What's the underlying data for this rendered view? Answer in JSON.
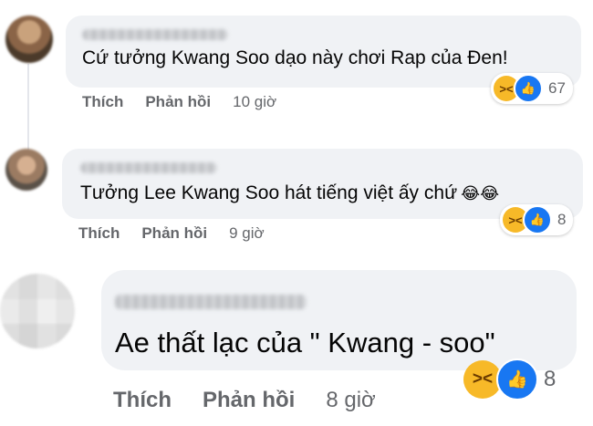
{
  "comments": [
    {
      "text": "Cứ tưởng Kwang Soo dạo này chơi Rap của Đen!",
      "like_label": "Thích",
      "reply_label": "Phản hồi",
      "time": "10 giờ",
      "reaction_count": "67",
      "reaction_icons": [
        "haha-icon",
        "like-icon"
      ]
    },
    {
      "text": "Tưởng Lee Kwang Soo hát tiếng việt ấy chứ",
      "inline_emoji": "😂😂",
      "like_label": "Thích",
      "reply_label": "Phản hồi",
      "time": "9 giờ",
      "reaction_count": "8",
      "reaction_icons": [
        "haha-icon",
        "like-icon"
      ]
    },
    {
      "text": "Ae thất lạc của \" Kwang - soo\"",
      "like_label": "Thích",
      "reply_label": "Phản hồi",
      "time": "8 giờ",
      "reaction_count": "8",
      "reaction_icons": [
        "haha-icon",
        "like-icon"
      ]
    }
  ],
  "colors": {
    "bubble_bg": "#f0f2f5",
    "action_text": "#65676b",
    "like_blue": "#1877f2",
    "haha_yellow": "#f7b928"
  }
}
